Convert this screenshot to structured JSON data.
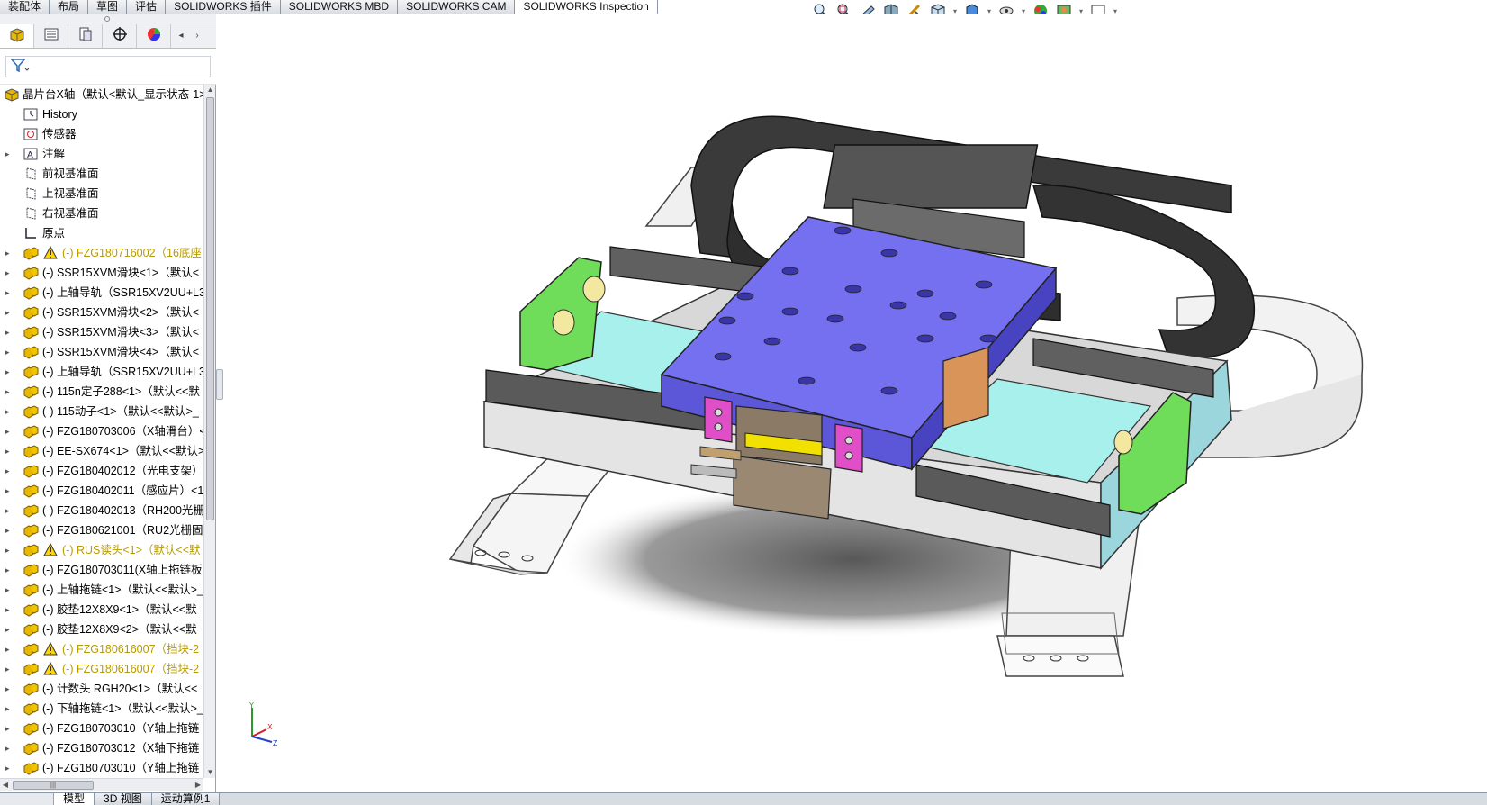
{
  "command_tabs": [
    "装配体",
    "布局",
    "草图",
    "评估",
    "SOLIDWORKS 插件",
    "SOLIDWORKS MBD",
    "SOLIDWORKS CAM",
    "SOLIDWORKS Inspection"
  ],
  "panel_tabs": [
    {
      "icon": "feature-manager-icon"
    },
    {
      "icon": "property-manager-icon"
    },
    {
      "icon": "configuration-manager-icon"
    },
    {
      "icon": "dimxpert-icon"
    },
    {
      "icon": "display-manager-icon"
    }
  ],
  "tree": {
    "root": "晶片台X轴（默认<默认_显示状态-1>",
    "items": [
      {
        "label": "History",
        "icon": "history-icon",
        "expand": false
      },
      {
        "label": "传感器",
        "icon": "sensor-icon",
        "expand": false
      },
      {
        "label": "注解",
        "icon": "annotation-icon",
        "expand": true
      },
      {
        "label": "前视基准面",
        "icon": "plane-icon",
        "expand": false
      },
      {
        "label": "上视基准面",
        "icon": "plane-icon",
        "expand": false
      },
      {
        "label": "右视基准面",
        "icon": "plane-icon",
        "expand": false
      },
      {
        "label": "原点",
        "icon": "origin-icon",
        "expand": false
      },
      {
        "label": "(-) FZG180716002（16底座",
        "icon": "part-icon",
        "expand": true,
        "warn": true
      },
      {
        "label": "(-) SSR15XVM滑块<1>（默认<",
        "icon": "part-icon",
        "expand": true
      },
      {
        "label": "(-) 上轴导轨（SSR15XV2UU+L3",
        "icon": "part-icon",
        "expand": true
      },
      {
        "label": "(-) SSR15XVM滑块<2>（默认<",
        "icon": "part-icon",
        "expand": true
      },
      {
        "label": "(-) SSR15XVM滑块<3>（默认<",
        "icon": "part-icon",
        "expand": true
      },
      {
        "label": "(-) SSR15XVM滑块<4>（默认<",
        "icon": "part-icon",
        "expand": true
      },
      {
        "label": "(-) 上轴导轨（SSR15XV2UU+L3",
        "icon": "part-icon",
        "expand": true
      },
      {
        "label": "(-) 115n定子288<1>（默认<<默",
        "icon": "part-icon",
        "expand": true
      },
      {
        "label": "(-) 115动子<1>（默认<<默认>_",
        "icon": "part-icon",
        "expand": true
      },
      {
        "label": "(-) FZG180703006（X轴滑台）<",
        "icon": "part-icon",
        "expand": true
      },
      {
        "label": "(-) EE-SX674<1>（默认<<默认>",
        "icon": "part-icon",
        "expand": true
      },
      {
        "label": "(-) FZG180402012（光电支架）",
        "icon": "part-icon",
        "expand": true
      },
      {
        "label": "(-) FZG180402011（感应片）<1",
        "icon": "part-icon",
        "expand": true
      },
      {
        "label": "(-) FZG180402013（RH200光栅",
        "icon": "part-icon",
        "expand": true
      },
      {
        "label": "(-) FZG180621001（RU2光栅固",
        "icon": "part-icon",
        "expand": true
      },
      {
        "label": "(-) RUS读头<1>（默认<<默",
        "icon": "part-icon",
        "expand": true,
        "warn": true
      },
      {
        "label": "(-) FZG180703011(X轴上拖链板",
        "icon": "part-icon",
        "expand": true
      },
      {
        "label": "(-) 上轴拖链<1>（默认<<默认>_",
        "icon": "part-icon",
        "expand": true
      },
      {
        "label": "(-) 胶垫12X8X9<1>（默认<<默",
        "icon": "part-icon",
        "expand": true
      },
      {
        "label": "(-) 胶垫12X8X9<2>（默认<<默",
        "icon": "part-icon",
        "expand": true
      },
      {
        "label": "(-) FZG180616007（挡块-2",
        "icon": "part-icon",
        "expand": true,
        "warn": true
      },
      {
        "label": "(-) FZG180616007（挡块-2",
        "icon": "part-icon",
        "expand": true,
        "warn": true
      },
      {
        "label": "(-) 计数头 RGH20<1>（默认<<",
        "icon": "part-icon",
        "expand": true
      },
      {
        "label": "(-) 下轴拖链<1>（默认<<默认>_",
        "icon": "part-icon",
        "expand": true
      },
      {
        "label": "(-) FZG180703010（Y轴上拖链",
        "icon": "part-icon",
        "expand": true
      },
      {
        "label": "(-) FZG180703012（X轴下拖链",
        "icon": "part-icon",
        "expand": true
      },
      {
        "label": "(-) FZG180703010（Y轴上拖链",
        "icon": "part-icon",
        "expand": true
      }
    ]
  },
  "bottom_tabs": [
    "模型",
    "3D 视图",
    "运动算例1"
  ],
  "hud_icons": [
    "zoom-to-fit-icon",
    "zoom-to-area-icon",
    "previous-view-icon",
    "section-view-icon",
    "dynamic-annotation-icon",
    "view-orientation-icon",
    "display-style-icon",
    "hide-show-icon",
    "edit-appearance-icon",
    "apply-scene-icon",
    "view-settings-icon"
  ],
  "colors": {
    "panel_bg": "#eef0f3",
    "warn_text": "#b89b00",
    "part_icon": "#e8b800",
    "table_top": "#7070ee",
    "slider": "#a8f0ec",
    "bracket_green": "#6fdc5a",
    "chain_dark": "#3a3a3a",
    "base_light": "#f2f2f2"
  }
}
